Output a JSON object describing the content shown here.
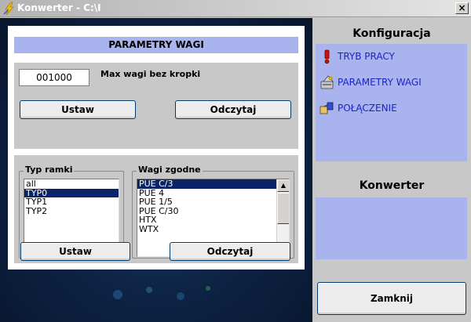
{
  "window": {
    "title": "Konwerter - C:\\I",
    "close_label": "×"
  },
  "dialog": {
    "header": "PARAMETRY WAGI",
    "max_value": "001000",
    "max_label": "Max wagi bez kropki",
    "set_label": "Ustaw",
    "read_label": "Odczytaj",
    "frame_group": {
      "legend": "Typ ramki",
      "items": [
        "all",
        "TYP0",
        "TYP1",
        "TYP2"
      ],
      "selected": "TYP0"
    },
    "scales_group": {
      "legend": "Wagi zgodne",
      "items": [
        "PUE C/3",
        "PUE 4",
        "PUE 1/5",
        "PUE C/30",
        "HTX",
        "WTX"
      ],
      "selected": "PUE C/3"
    },
    "set2_label": "Ustaw",
    "read2_label": "Odczytaj"
  },
  "config": {
    "title": "Konfiguracja",
    "items": [
      "TRYB PRACY",
      "PARAMETRY WAGI",
      "POŁĄCZENIE"
    ]
  },
  "converter": {
    "title": "Konwerter"
  },
  "close_button": "Zamknij",
  "colors": {
    "panel": "#a9b3ee",
    "link": "#1a25c7",
    "selection": "#0a246a"
  }
}
